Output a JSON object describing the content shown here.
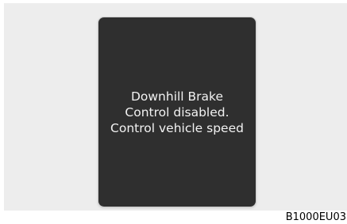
{
  "display": {
    "message_lines": [
      "Downhill Brake",
      "Control disabled.",
      "Control vehicle speed"
    ]
  },
  "figure_code": "B1000EU03"
}
